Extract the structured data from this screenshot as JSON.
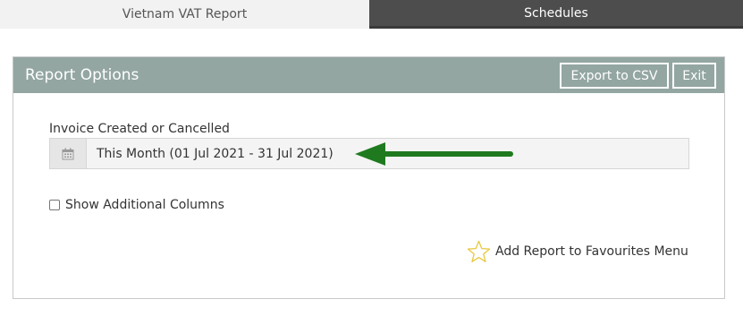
{
  "tabs": [
    {
      "label": "Vietnam VAT Report",
      "active": true
    },
    {
      "label": "Schedules",
      "active": false
    }
  ],
  "panel": {
    "title": "Report Options",
    "buttons": {
      "export_label": "Export to CSV",
      "exit_label": "Exit"
    }
  },
  "filter": {
    "label": "Invoice Created or Cancelled",
    "value": "This Month (01 Jul 2021 - 31 Jul 2021)",
    "icon": "calendar-icon"
  },
  "options": {
    "show_additional_columns_label": "Show Additional Columns",
    "show_additional_columns_checked": false
  },
  "favourites": {
    "label": "Add Report to Favourites Menu",
    "icon": "star-icon"
  },
  "colors": {
    "header_bg": "#93a6a2",
    "active_tab_bg": "#f2f2f2",
    "inactive_tab_bg": "#4d4d4d",
    "arrow": "#1f7a1f",
    "star": "#e8c840"
  }
}
